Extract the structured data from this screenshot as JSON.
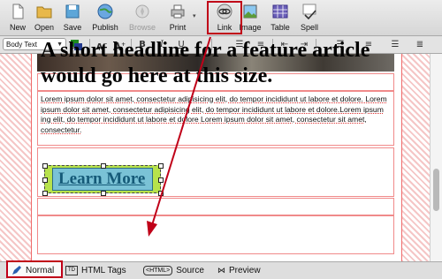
{
  "toolbar": {
    "new": "New",
    "open": "Open",
    "save": "Save",
    "publish": "Publish",
    "browse": "Browse",
    "print": "Print",
    "link": "Link",
    "image": "Image",
    "table": "Table",
    "spell": "Spell"
  },
  "format_bar": {
    "paragraph_style": "Body Text"
  },
  "document": {
    "headline": "A short headline for a feature article would go here at this size.",
    "body": "Lorem ipsum dolor sit amet, consectetur adipisicing elit, do tempor incididunt ut labore et dolore. Lorem ipsum dolor sit amet, consectetur adipisicing elit, do tempor incididunt ut labore et dolore.Lorem ipsum ing elit, do tempor incididunt ut labore et dolore Lorem ipsum dolor sit amet, consectetur sit amet, consectetur.",
    "button_label": "Learn More"
  },
  "view_tabs": {
    "normal": "Normal",
    "html_tags": "HTML Tags",
    "source": "Source",
    "preview": "Preview"
  },
  "highlight_color": "#c00018"
}
